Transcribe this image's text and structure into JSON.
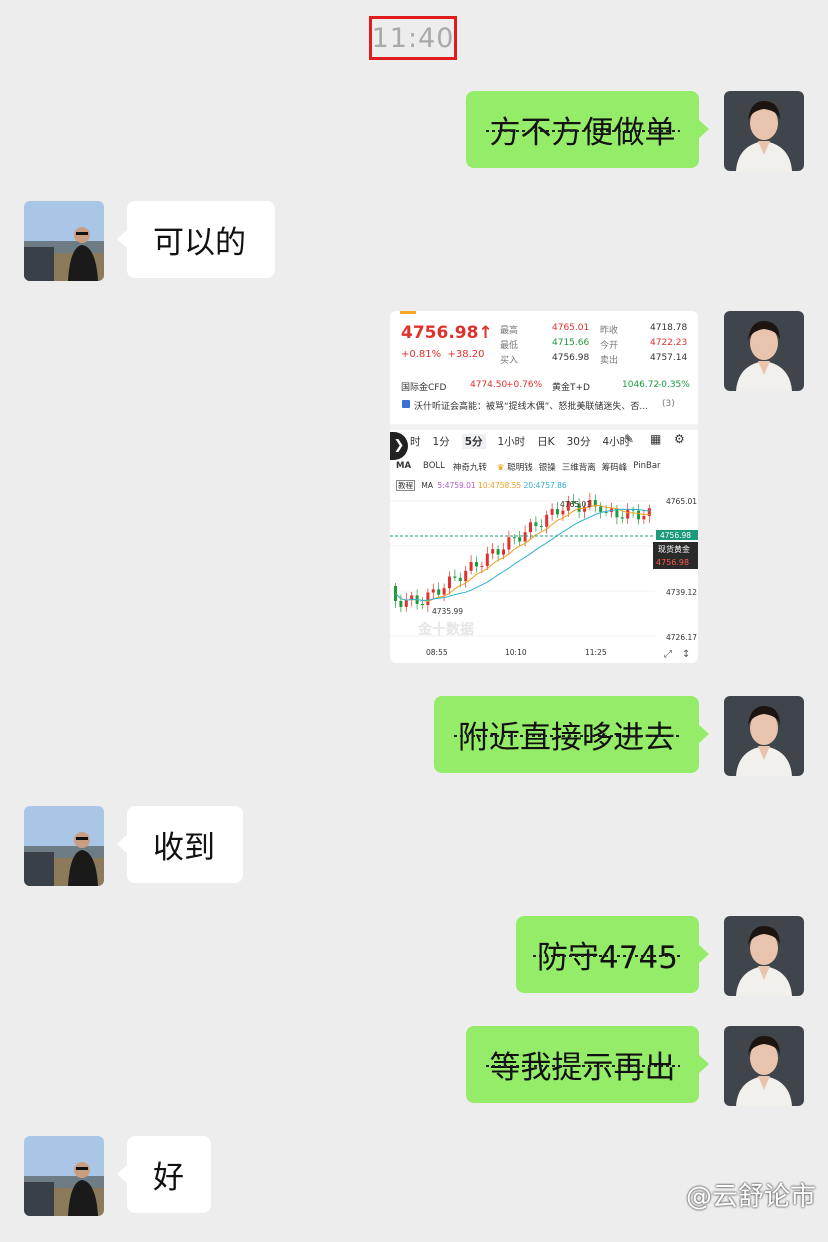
{
  "time": "11:40",
  "messages": [
    {
      "side": "out",
      "text": "方不方便做单"
    },
    {
      "side": "in",
      "text": "可以的"
    },
    {
      "side": "out",
      "type": "image"
    },
    {
      "side": "out",
      "text": "附近直接哆进去"
    },
    {
      "side": "in",
      "text": "收到"
    },
    {
      "side": "out",
      "text": "防守4745"
    },
    {
      "side": "out",
      "text": "等我提示再出"
    },
    {
      "side": "in",
      "text": "好"
    }
  ],
  "quote": {
    "price": "4756.98",
    "change_pct": "+0.81%",
    "change": "+38.20",
    "high_label": "最高",
    "high": "4765.01",
    "low_label": "最低",
    "low": "4715.66",
    "buy_label": "买入",
    "buy": "4756.98",
    "prev_label": "昨收",
    "prev": "4718.78",
    "open_label": "今开",
    "open": "4722.23",
    "sell_label": "卖出",
    "sell": "4757.14",
    "cfd_label": "国际金CFD",
    "cfd_price": "4774.50",
    "cfd_pct": "+0.76%",
    "td_label": "黄金T+D",
    "td_price": "1046.72",
    "td_pct": "-0.35%",
    "news": "沃什听证会高能：被骂“提线木偶”、怒批美联储迷失、否...",
    "news_count": "(3)"
  },
  "chart_tabs": [
    "时",
    "1分",
    "5分",
    "1小时",
    "日K",
    "30分",
    "4小时"
  ],
  "indicators": [
    "MA",
    "BOLL",
    "神奇九转",
    "聪明钱",
    "银操",
    "三维背离",
    "筹码峰",
    "PinBar"
  ],
  "ma_line": {
    "tag": "教程",
    "label": "MA",
    "ma5": "5:4759.01",
    "ma10": "10:4758.55",
    "ma20": "20:4757.86"
  },
  "chart_data": {
    "type": "candlestick",
    "y_ticks": [
      "4765.01",
      "4739.12",
      "4726.17"
    ],
    "x_ticks": [
      "08:55",
      "10:10",
      "11:25"
    ],
    "high_mark": "4765.01",
    "low_mark": "4735.99",
    "last_price": "4756.98",
    "last_label": "现货黄金",
    "watermark": "金十数据"
  },
  "footer_watermark": "@云舒论市",
  "colors": {
    "out_bubble": "#95ec69",
    "in_bubble": "#ffffff",
    "bg": "#ededed",
    "up": "#e0312b",
    "down": "#1d9a3c"
  }
}
